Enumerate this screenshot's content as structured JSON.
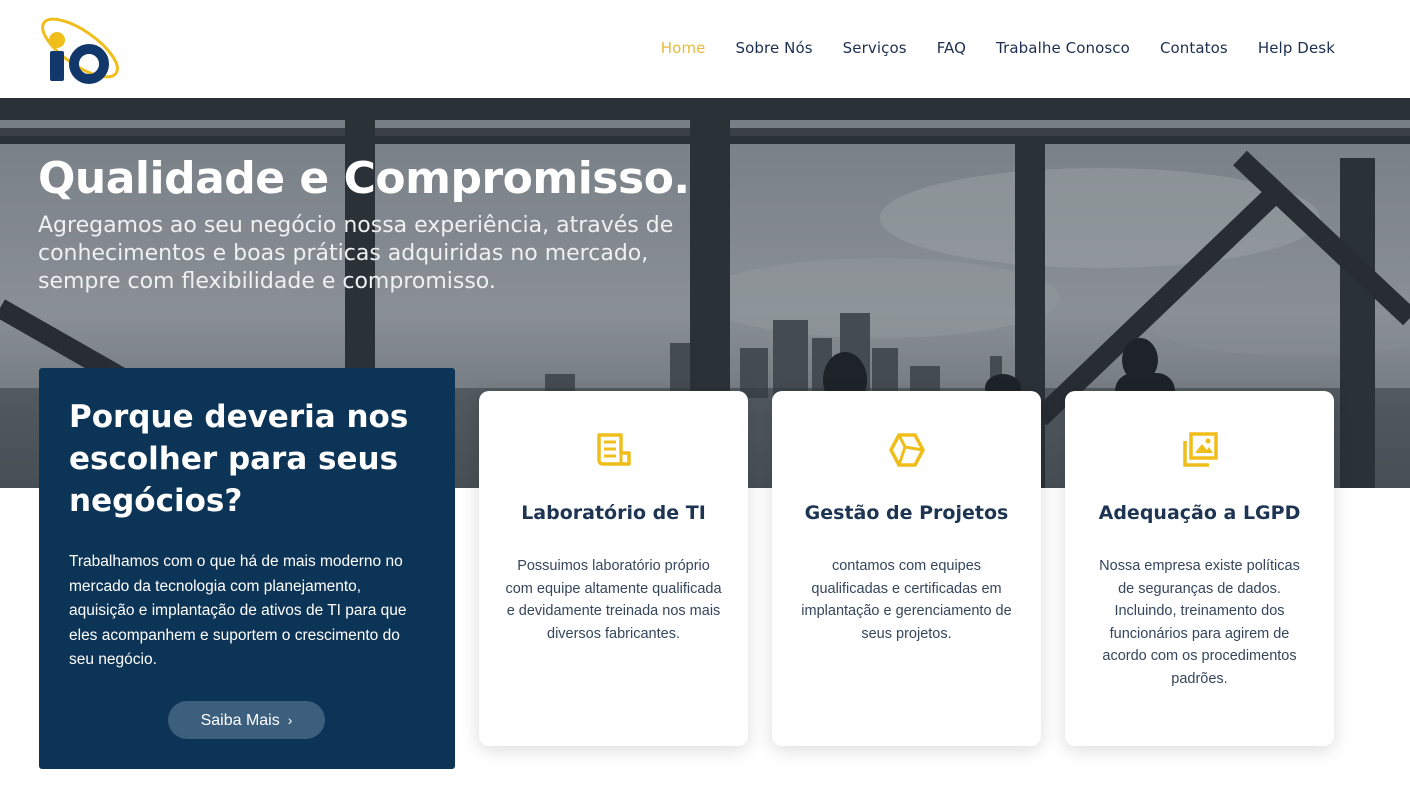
{
  "header": {
    "logo_text": "iQ",
    "nav": [
      {
        "label": "Home",
        "active": true
      },
      {
        "label": "Sobre Nós",
        "active": false
      },
      {
        "label": "Serviços",
        "active": false
      },
      {
        "label": "FAQ",
        "active": false
      },
      {
        "label": "Trabalhe Conosco",
        "active": false
      },
      {
        "label": "Contatos",
        "active": false
      },
      {
        "label": "Help Desk",
        "active": false
      }
    ]
  },
  "hero": {
    "title": "Qualidade e Compromisso.",
    "subtitle": "Agregamos ao seu negócio nossa experiência, através de conhecimentos e boas práticas adquiridas no mercado, sempre com flexibilidade e compromisso."
  },
  "why": {
    "title": "Porque deveria nos escolher para seus negócios?",
    "text": "Trabalhamos com o que há de mais moderno no mercado da tecnologia com planejamento, aquisição e implantação de ativos de TI para que eles acompanhem e suportem o crescimento do seu negócio.",
    "button_label": "Saiba Mais",
    "button_icon": "chevron-right-icon"
  },
  "cards": [
    {
      "icon": "document-icon",
      "title": "Laboratório de TI",
      "text": "Possuimos laboratório próprio com equipe altamente qualificada e devidamente treinada nos mais diversos fabricantes."
    },
    {
      "icon": "hexagon-box-icon",
      "title": "Gestão de Projetos",
      "text": "contamos com equipes qualificadas e certificadas em implantação e gerenciamento de seus projetos."
    },
    {
      "icon": "images-icon",
      "title": "Adequação a LGPD",
      "text": "Nossa empresa existe políticas de seguranças de dados. Incluindo, treinamento dos funcionários para agirem de acordo com os procedimentos padrões."
    }
  ],
  "colors": {
    "accent": "#e8b93a",
    "navy": "#0c3457",
    "nav_text": "#1d2f4f",
    "button": "#3c5f7d",
    "logo_blue": "#12386b",
    "icon_yellow": "#f0be1b"
  }
}
